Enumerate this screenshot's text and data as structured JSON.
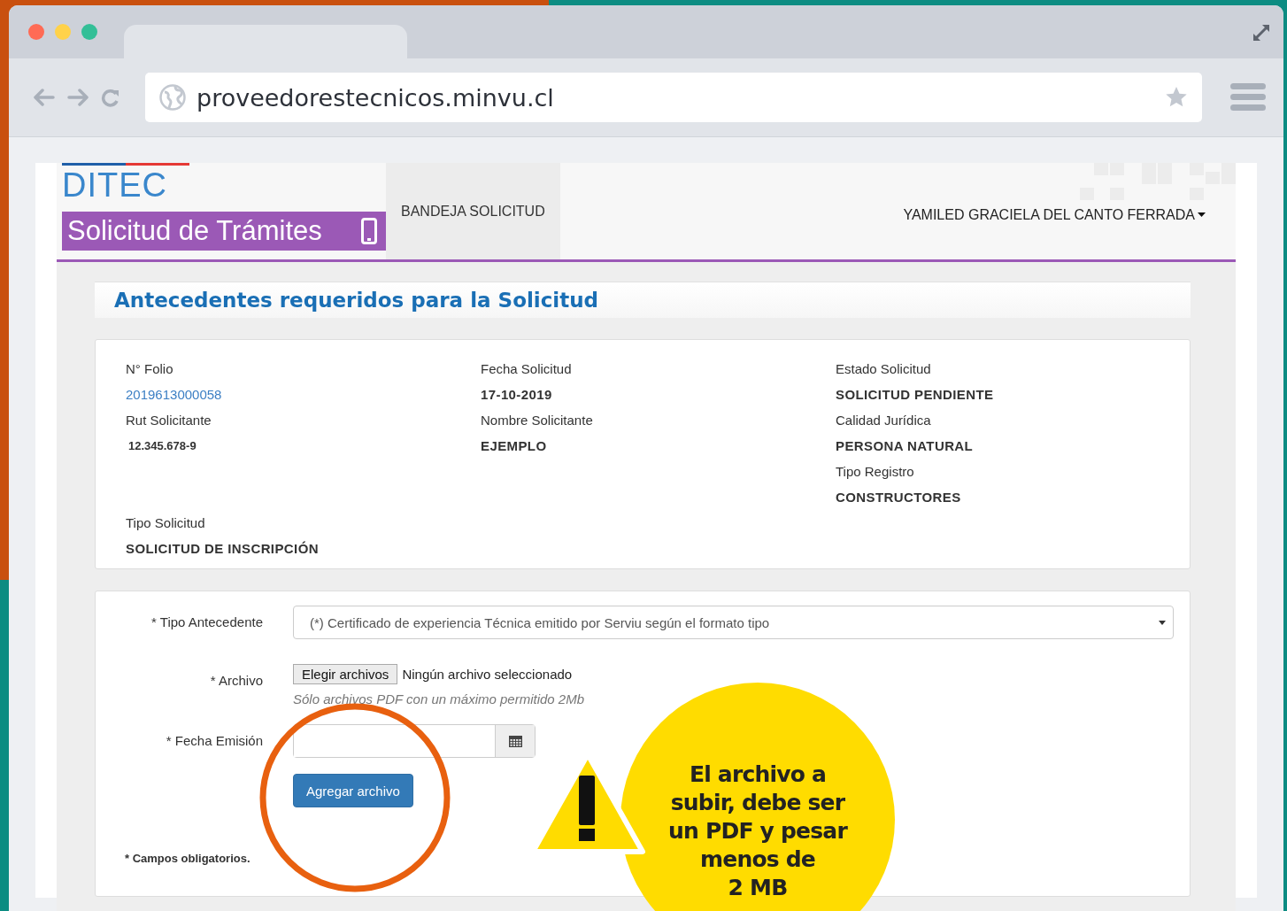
{
  "browser": {
    "url": "proveedorestecnicos.minvu.cl"
  },
  "header": {
    "logo": "DITEC",
    "app_title": "Solicitud de Trámites",
    "nav": [
      {
        "label": "BANDEJA SOLICITUD",
        "selected": true
      }
    ],
    "user": "YAMILED GRACIELA DEL CANTO FERRADA"
  },
  "section_title": "Antecedentes requeridos para la Solicitud",
  "details": {
    "columns": [
      [
        {
          "label": "N° Folio",
          "value": "2019613000058",
          "kind": "link"
        },
        {
          "label": "Rut Solicitante",
          "value": "12.345.678-9",
          "kind": "compact"
        }
      ],
      [
        {
          "label": "Fecha Solicitud",
          "value": "17-10-2019",
          "kind": "bold"
        },
        {
          "label": "Nombre Solicitante",
          "value": "EJEMPLO",
          "kind": "bold"
        }
      ],
      [
        {
          "label": "Estado Solicitud",
          "value": "SOLICITUD PENDIENTE",
          "kind": "bold"
        },
        {
          "label": "Calidad Jurídica",
          "value": "PERSONA NATURAL",
          "kind": "bold"
        },
        {
          "label": "Tipo Registro",
          "value": "CONSTRUCTORES",
          "kind": "bold"
        }
      ]
    ],
    "extra": {
      "label": "Tipo Solicitud",
      "value": "SOLICITUD DE INSCRIPCIÓN",
      "kind": "bold"
    }
  },
  "form": {
    "fields": [
      {
        "kind": "select",
        "label": "* Tipo Antecedente",
        "value": "(*) Certificado de experiencia Técnica emitido por Serviu según el formato tipo"
      },
      {
        "kind": "file",
        "label": "* Archivo",
        "button": "Elegir archivos",
        "status": "Ningún archivo seleccionado",
        "hint": "Sólo archivos PDF con un máximo permitido 2Mb"
      },
      {
        "kind": "date",
        "label": "* Fecha Emisión"
      }
    ],
    "submit": "Agregar archivo",
    "note": "* Campos obligatorios."
  },
  "callout": {
    "text": "El archivo a\nsubir, debe ser\nun PDF y pesar\nmenos de\n2 MB"
  }
}
